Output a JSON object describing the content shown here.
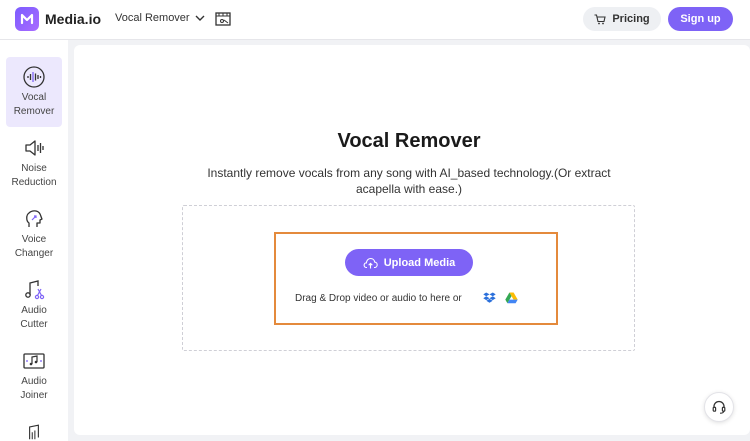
{
  "header": {
    "brand": "Media.io",
    "product_select": "Vocal Remover",
    "pricing_label": "Pricing",
    "signup_label": "Sign up"
  },
  "sidebar": {
    "items": [
      {
        "line1": "Vocal",
        "line2": "Remover",
        "icon": "vocal-remover-icon",
        "active": true
      },
      {
        "line1": "Noise",
        "line2": "Reduction",
        "icon": "speaker-icon",
        "active": false
      },
      {
        "line1": "Voice",
        "line2": "Changer",
        "icon": "voice-changer-icon",
        "active": false
      },
      {
        "line1": "Audio",
        "line2": "Cutter",
        "icon": "audio-cutter-icon",
        "active": false
      },
      {
        "line1": "Audio",
        "line2": "Joiner",
        "icon": "audio-joiner-icon",
        "active": false
      }
    ]
  },
  "main": {
    "title": "Vocal Remover",
    "subtitle": "Instantly remove vocals from any song with AI_based technology.(Or extract acapella with ease.)",
    "upload_label": "Upload Media",
    "drag_text": "Drag & Drop video or audio to here or"
  },
  "colors": {
    "accent": "#7e63f6",
    "highlight": "#e48a3c",
    "sidebar_active": "#ece8fd"
  }
}
